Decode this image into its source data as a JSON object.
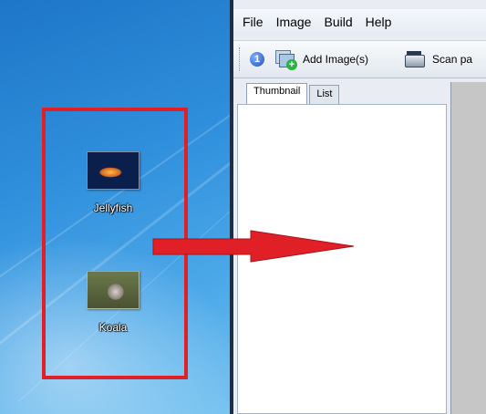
{
  "desktop": {
    "icons": [
      {
        "label": "Jellyfish"
      },
      {
        "label": "Koala"
      }
    ]
  },
  "app": {
    "menu": [
      "File",
      "Image",
      "Build",
      "Help"
    ],
    "toolbar": {
      "info_glyph": "1",
      "add_images_label": "Add Image(s)",
      "scan_label": "Scan pa"
    },
    "tabs": [
      "Thumbnail",
      "List"
    ],
    "active_tab": "Thumbnail"
  },
  "colors": {
    "highlight_red": "#e01f27",
    "desktop_blue": "#2f8fdc"
  }
}
